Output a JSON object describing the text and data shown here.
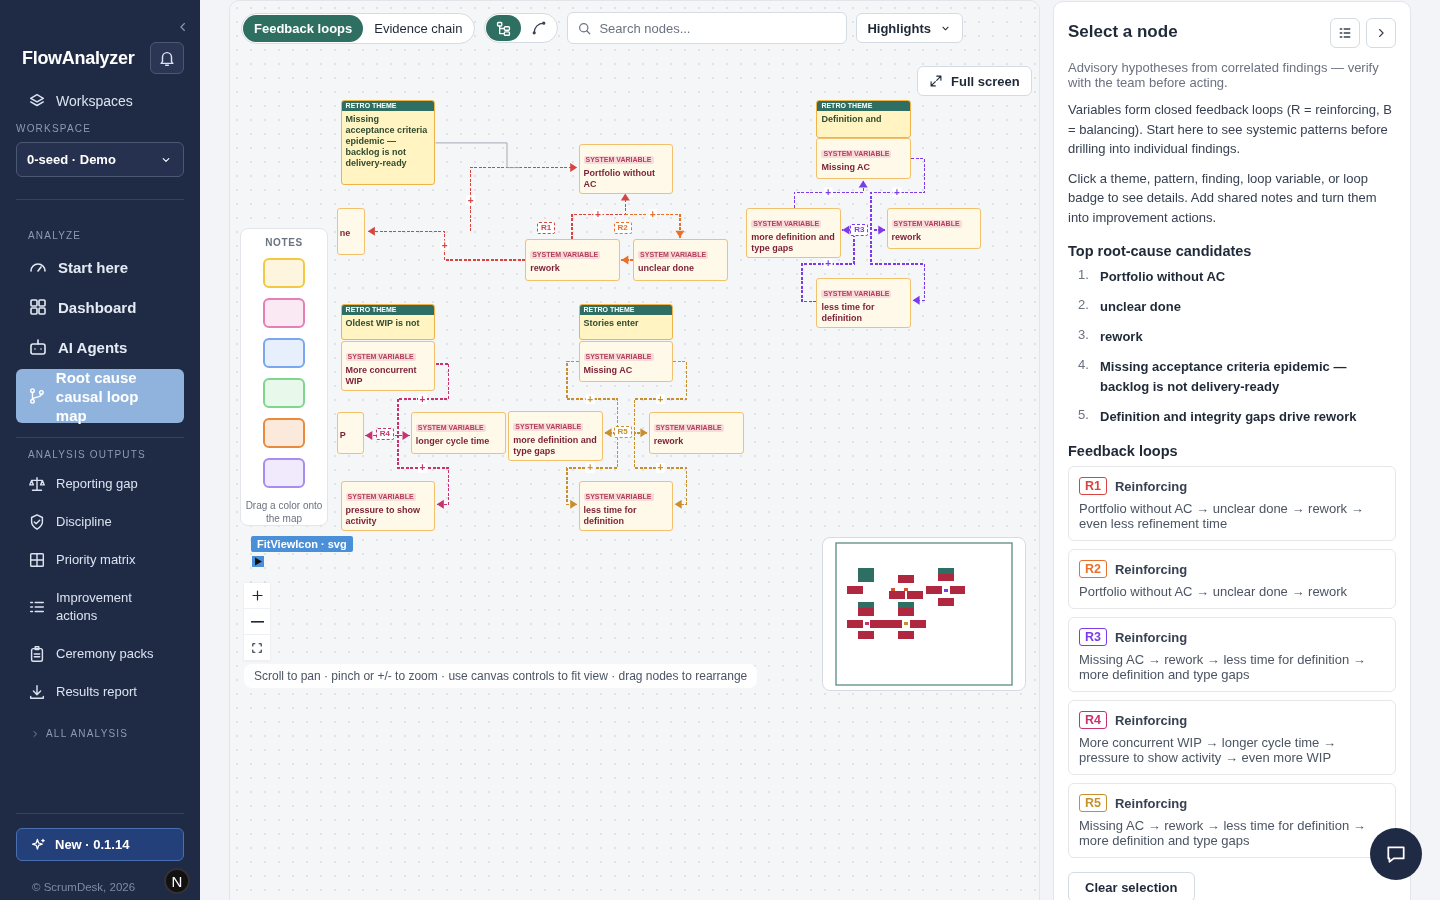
{
  "sidebar": {
    "app_name": "FlowAnalyzer",
    "workspaces_link": "Workspaces",
    "workspace_label": "WORKSPACE",
    "workspace_select": "0-seed · Demo",
    "analyze": {
      "title": "ANALYZE",
      "items": [
        {
          "label": "Start here",
          "selected": false
        },
        {
          "label": "Dashboard",
          "selected": false
        },
        {
          "label": "AI Agents",
          "selected": false
        },
        {
          "label": "Root cause causal loop map",
          "selected": true
        }
      ]
    },
    "analysis_outputs": {
      "title": "ANALYSIS OUTPUTS",
      "items": [
        {
          "label": "Reporting gap",
          "selected": false
        },
        {
          "label": "Discipline",
          "selected": false
        },
        {
          "label": "Priority matrix",
          "selected": false
        },
        {
          "label": "Improvement actions",
          "selected": false
        },
        {
          "label": "Ceremony packs",
          "selected": false
        },
        {
          "label": "Results report",
          "selected": false
        }
      ]
    },
    "all_analysis": {
      "label": "ALL ANALYSIS",
      "expanded": false
    },
    "version_button": "New · 0.1.14",
    "copyright": "© ScrumDesk, 2026",
    "dev_badge": "N"
  },
  "toolbar": {
    "view_tabs": [
      {
        "label": "Feedback loops",
        "selected": true
      },
      {
        "label": "Evidence chain",
        "selected": false
      }
    ],
    "layout_toggle": [
      {
        "kind": "tree",
        "selected": true
      },
      {
        "kind": "curve",
        "selected": false
      }
    ],
    "search": {
      "placeholder": "Search nodes..."
    },
    "highlights": "Highlights"
  },
  "canvas": {
    "full_screen": "Full screen",
    "themes": [
      {
        "tag": "RETRO THEME",
        "title": "Missing acceptance criteria epidemic — backlog is not delivery-ready"
      },
      {
        "tag": "RETRO THEME",
        "title": "Definition and"
      },
      {
        "tag": "RETRO THEME",
        "title": "Oldest WIP is not"
      },
      {
        "tag": "RETRO THEME",
        "title": "Stories enter"
      }
    ],
    "variables": [
      {
        "tag": "SYSTEM VARIABLE",
        "title": "Portfolio without AC"
      },
      {
        "tag": "SYSTEM VARIABLE",
        "title": "rework"
      },
      {
        "tag": "SYSTEM VARIABLE",
        "title": "unclear done"
      },
      {
        "title": "ne"
      },
      {
        "tag": "SYSTEM VARIABLE",
        "title": "Missing AC"
      },
      {
        "tag": "SYSTEM VARIABLE",
        "title": "more definition and type gaps"
      },
      {
        "tag": "SYSTEM VARIABLE",
        "title": "rework"
      },
      {
        "tag": "SYSTEM VARIABLE",
        "title": "less time for definition"
      },
      {
        "tag": "SYSTEM VARIABLE",
        "title": "More concurrent WIP"
      },
      {
        "title": "P"
      },
      {
        "tag": "SYSTEM VARIABLE",
        "title": "longer cycle time"
      },
      {
        "tag": "SYSTEM VARIABLE",
        "title": "pressure to show activity"
      },
      {
        "tag": "SYSTEM VARIABLE",
        "title": "Missing AC"
      },
      {
        "tag": "SYSTEM VARIABLE",
        "title": "more definition and type gaps"
      },
      {
        "tag": "SYSTEM VARIABLE",
        "title": "rework"
      },
      {
        "tag": "SYSTEM VARIABLE",
        "title": "less time for definition"
      }
    ],
    "loop_badges": [
      {
        "label": "R1",
        "color": "#d64541"
      },
      {
        "label": "R2",
        "color": "#e8702a"
      },
      {
        "label": "R3",
        "color": "#7c3aed"
      },
      {
        "label": "R4",
        "color": "#c8326e"
      },
      {
        "label": "R5",
        "color": "#c8902c"
      }
    ],
    "edges": [
      {
        "kind": "causal",
        "color": "#d64541",
        "sign": "+"
      },
      {
        "kind": "causal",
        "color": "#d64541",
        "sign": "+"
      },
      {
        "kind": "causal",
        "color": "#d64541",
        "sign": "+"
      },
      {
        "kind": "causal",
        "color": "#e8702a",
        "sign": "+"
      },
      {
        "kind": "causal",
        "color": "#e8702a"
      },
      {
        "kind": "causal",
        "color": "#7c3aed",
        "sign": "+"
      },
      {
        "kind": "causal",
        "color": "#7c3aed",
        "sign": "+"
      },
      {
        "kind": "causal",
        "color": "#7c3aed",
        "sign": "+"
      },
      {
        "kind": "causal",
        "color": "#7c3aed"
      },
      {
        "kind": "causal",
        "color": "#c8326e",
        "sign": "+"
      },
      {
        "kind": "causal",
        "color": "#c8326e",
        "sign": "+"
      },
      {
        "kind": "causal",
        "color": "#c8326e"
      },
      {
        "kind": "causal",
        "color": "#c8902c",
        "sign": "+"
      },
      {
        "kind": "causal",
        "color": "#c8902c",
        "sign": "+"
      },
      {
        "kind": "causal",
        "color": "#c8902c",
        "sign": "+"
      },
      {
        "kind": "causal",
        "color": "#c8902c",
        "sign": "+"
      },
      {
        "kind": "link"
      }
    ],
    "notes": {
      "title": "NOTES",
      "swatches": [
        {
          "color": "#f5c842"
        },
        {
          "color": "#e47fb8"
        },
        {
          "color": "#7aa7f0"
        },
        {
          "color": "#7fd68f"
        },
        {
          "color": "#e98a3c"
        },
        {
          "color": "#a98cf0"
        }
      ],
      "hint": "Drag a color onto the map"
    },
    "debug_label": "FitViewIcon · svg",
    "hint": "Scroll to pan · pinch or +/- to zoom · use canvas controls to fit view · drag nodes to rearrange"
  },
  "panel": {
    "title": "Select a node",
    "intro": "Advisory hypotheses from correlated findings — verify with the team before acting.",
    "paragraphs": [
      "Variables form closed feedback loops (R = reinforcing, B = balancing). Start here to see systemic patterns before drilling into individual findings.",
      "Click a theme, pattern, finding, loop variable, or loop badge to see details. Add shared notes and turn them into improvement actions."
    ],
    "candidates_title": "Top root-cause candidates",
    "candidates": [
      {
        "number": "1.",
        "text": "Portfolio without AC"
      },
      {
        "number": "2.",
        "text": "unclear done"
      },
      {
        "number": "3.",
        "text": "rework"
      },
      {
        "number": "4.",
        "text": "Missing acceptance criteria epidemic — backlog is not delivery-ready"
      },
      {
        "number": "5.",
        "text": "Definition and integrity gaps drive rework"
      }
    ],
    "loops_title": "Feedback loops",
    "loops": [
      {
        "badge": "R1",
        "color": "#d64541",
        "type": "Reinforcing",
        "path": "Portfolio without AC → unclear done → rework → even less refinement time"
      },
      {
        "badge": "R2",
        "color": "#e8702a",
        "type": "Reinforcing",
        "path": "Portfolio without AC → unclear done → rework"
      },
      {
        "badge": "R3",
        "color": "#7c3aed",
        "type": "Reinforcing",
        "path": "Missing AC → rework → less time for definition → more definition and type gaps"
      },
      {
        "badge": "R4",
        "color": "#c8326e",
        "type": "Reinforcing",
        "path": "More concurrent WIP → longer cycle time → pressure to show activity → even more WIP"
      },
      {
        "badge": "R5",
        "color": "#c8902c",
        "type": "Reinforcing",
        "path": "Missing AC → rework → less time for definition → more definition and type gaps"
      }
    ],
    "clear_button": "Clear selection"
  }
}
